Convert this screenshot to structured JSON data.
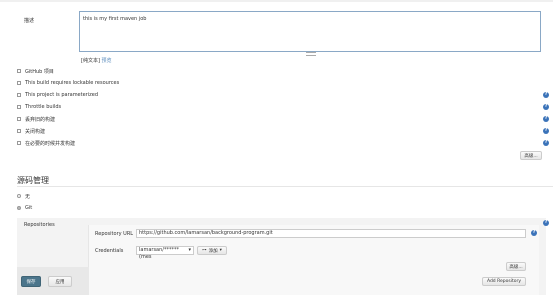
{
  "description": {
    "label": "描述",
    "value": "this is my first maven job",
    "format_links": {
      "escape": "[纯文本]",
      "preview": "预览"
    }
  },
  "options": [
    {
      "label": "GitHub 项目",
      "checked": false,
      "help": false
    },
    {
      "label": "This build requires lockable resources",
      "checked": false,
      "help": false
    },
    {
      "label": "This project is parameterized",
      "checked": false,
      "help": true
    },
    {
      "label": "Throttle builds",
      "checked": false,
      "help": true
    },
    {
      "label": "丢弃旧的构建",
      "checked": false,
      "help": true
    },
    {
      "label": "关闭构建",
      "checked": false,
      "help": true
    },
    {
      "label": "在必要的时候并发构建",
      "checked": false,
      "help": true
    }
  ],
  "advanced_button": "高级...",
  "scm": {
    "title": "源码管理",
    "options": [
      {
        "label": "无",
        "selected": false
      },
      {
        "label": "Git",
        "selected": true
      }
    ],
    "repositories_label": "Repositories",
    "repository_url_label": "Repository URL",
    "repository_url": "https://github.com/lamarsan/background-program.git",
    "credentials_label": "Credentials",
    "credentials_value": "lamarsan/****** (mes",
    "add_button": "添加",
    "advanced_button": "高级...",
    "add_repository_button": "Add Repository"
  },
  "footer": {
    "save": "保存",
    "apply": "应用"
  },
  "colors": {
    "help_icon": "#3b73b9",
    "save_button": "#4b758b",
    "link": "#5588bb"
  }
}
